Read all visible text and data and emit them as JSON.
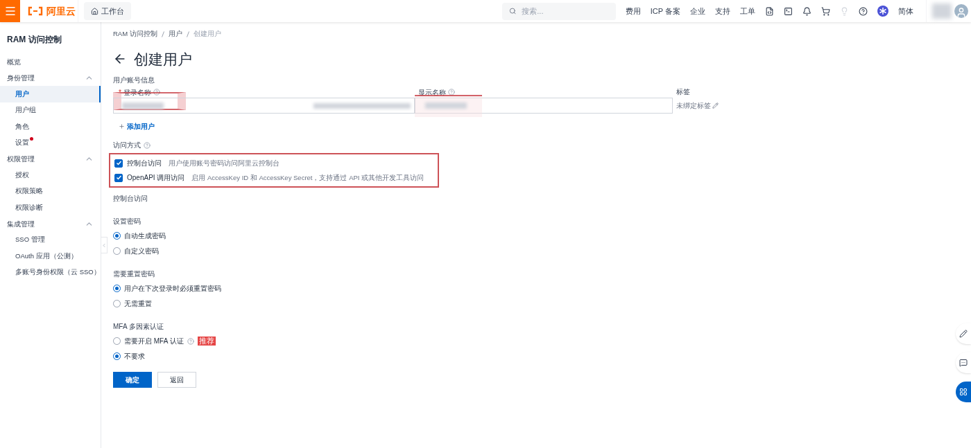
{
  "header": {
    "brand": "阿里云",
    "workbench": "工作台",
    "search_placeholder": "搜索...",
    "links": [
      "费用",
      "ICP 备案",
      "企业",
      "支持",
      "工单"
    ],
    "language": "简体"
  },
  "sidebar": {
    "title": "RAM 访问控制",
    "items": [
      {
        "label": "概览",
        "kind": "link",
        "selected": false
      },
      {
        "label": "身份管理",
        "kind": "group",
        "expanded": true,
        "children": [
          {
            "label": "用户",
            "selected": true,
            "dot": false
          },
          {
            "label": "用户组",
            "selected": false,
            "dot": false
          },
          {
            "label": "角色",
            "selected": false,
            "dot": false
          },
          {
            "label": "设置",
            "selected": false,
            "dot": true
          }
        ]
      },
      {
        "label": "权限管理",
        "kind": "group",
        "expanded": true,
        "children": [
          {
            "label": "授权",
            "selected": false,
            "dot": false
          },
          {
            "label": "权限策略",
            "selected": false,
            "dot": false
          },
          {
            "label": "权限诊断",
            "selected": false,
            "dot": false
          }
        ]
      },
      {
        "label": "集成管理",
        "kind": "group",
        "expanded": true,
        "children": [
          {
            "label": "SSO 管理",
            "selected": false,
            "dot": false
          },
          {
            "label": "OAuth 应用（公测）",
            "selected": false,
            "dot": false
          },
          {
            "label": "多账号身份权限（云 SSO）",
            "selected": false,
            "dot": false
          }
        ]
      }
    ]
  },
  "breadcrumb": [
    "RAM 访问控制",
    "用户",
    "创建用户"
  ],
  "page_title": "创建用户",
  "account": {
    "label": "用户账号信息",
    "login_name": {
      "label": "登录名称",
      "required_mark": "*",
      "highlighted": true
    },
    "display_name": {
      "label": "显示名称",
      "highlighted": true
    },
    "tags": {
      "label": "标签",
      "value": "未绑定标签"
    },
    "add_user": "添加用户"
  },
  "access": {
    "label": "访问方式",
    "highlighted": true,
    "options": [
      {
        "label": "控制台访问",
        "description": "用户使用账号密码访问阿里云控制台",
        "checked": true
      },
      {
        "label": "OpenAPI 调用访问",
        "description": "启用 AccessKey ID 和 AccessKey Secret，支持通过 API 或其他开发工具访问",
        "checked": true
      }
    ]
  },
  "console_access_label": "控制台访问",
  "radio_groups": [
    {
      "title": "设置密码",
      "options": [
        {
          "label": "自动生成密码",
          "selected": true
        },
        {
          "label": "自定义密码",
          "selected": false
        }
      ]
    },
    {
      "title": "需要重置密码",
      "options": [
        {
          "label": "用户在下次登录时必须重置密码",
          "selected": true
        },
        {
          "label": "无需重置",
          "selected": false
        }
      ]
    },
    {
      "title": "MFA 多因素认证",
      "options": [
        {
          "label": "需要开启 MFA 认证",
          "selected": false,
          "help": true,
          "badge": "推荐"
        },
        {
          "label": "不要求",
          "selected": true
        }
      ]
    }
  ],
  "buttons": [
    {
      "label": "确定",
      "kind": "primary"
    },
    {
      "label": "返回",
      "kind": "secondary"
    }
  ]
}
